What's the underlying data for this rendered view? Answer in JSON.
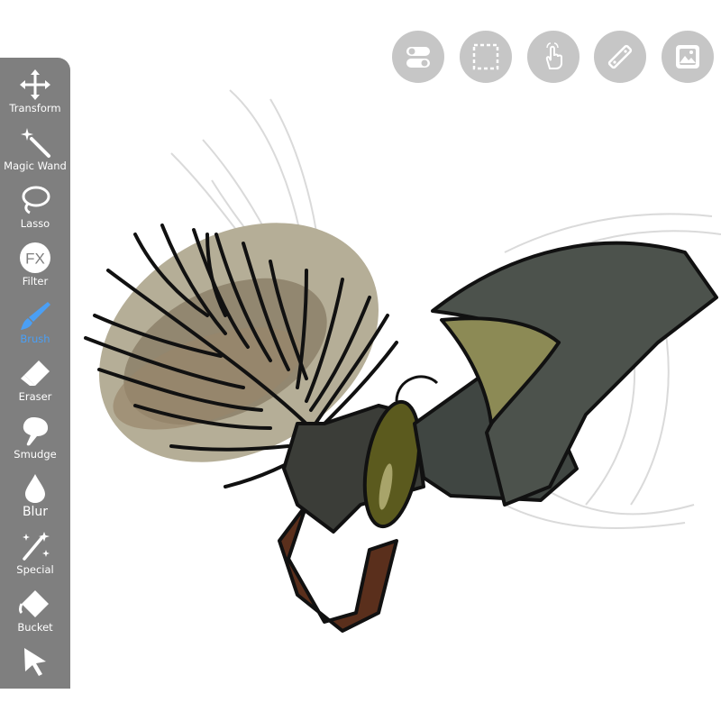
{
  "toolbar": {
    "tools": [
      {
        "label": "Transform",
        "icon": "transform-icon"
      },
      {
        "label": "Magic Wand",
        "icon": "magic-wand-icon"
      },
      {
        "label": "Lasso",
        "icon": "lasso-icon"
      },
      {
        "label": "Filter",
        "icon": "fx-icon",
        "icon_text": "FX"
      },
      {
        "label": "Brush",
        "icon": "brush-icon",
        "active": true
      },
      {
        "label": "Eraser",
        "icon": "eraser-icon"
      },
      {
        "label": "Smudge",
        "icon": "smudge-icon"
      },
      {
        "label": "Blur",
        "icon": "blur-drop-icon"
      },
      {
        "label": "Special",
        "icon": "special-sparkle-icon"
      },
      {
        "label": "Bucket",
        "icon": "bucket-icon"
      },
      {
        "label": "",
        "icon": "select-arrow-icon"
      }
    ]
  },
  "top_buttons": [
    {
      "icon": "toggle-settings-icon"
    },
    {
      "icon": "selection-marquee-icon"
    },
    {
      "icon": "touch-gesture-icon"
    },
    {
      "icon": "ruler-icon"
    },
    {
      "icon": "image-gallery-icon"
    }
  ],
  "colors": {
    "toolbar_bg": "#7f7f7f",
    "active_tool": "#4a9ff5",
    "top_button_bg": "#c6c6c6"
  }
}
